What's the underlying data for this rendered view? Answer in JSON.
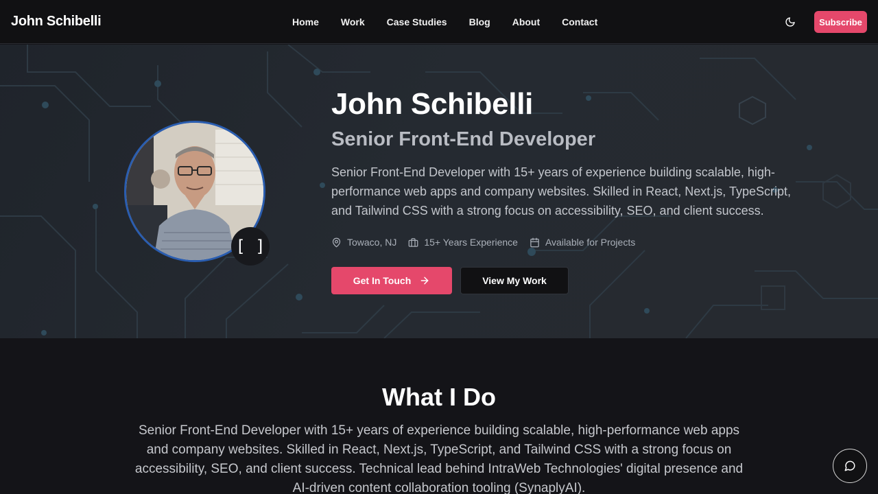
{
  "nav": {
    "brand": "John Schibelli",
    "links": [
      "Home",
      "Work",
      "Case Studies",
      "Blog",
      "About",
      "Contact"
    ],
    "subscribe_label": "Subscribe",
    "theme_icon": "moon-icon"
  },
  "hero": {
    "name": "John Schibelli",
    "role": "Senior Front-End Developer",
    "bio": "Senior Front-End Developer with 15+ years of experience building scalable, high-performance web apps and company websites. Skilled in React, Next.js, TypeScript, and Tailwind CSS with a strong focus on accessibility, SEO, and client success.",
    "meta": {
      "location": "Towaco, NJ",
      "experience": "15+ Years Experience",
      "availability": "Available for Projects"
    },
    "badge_glyph": "[ ]",
    "cta_primary": "Get In Touch",
    "cta_secondary": "View My Work"
  },
  "what_i_do": {
    "title": "What I Do",
    "text": "Senior Front-End Developer with 15+ years of experience building scalable, high-performance web apps and company websites. Skilled in React, Next.js, TypeScript, and Tailwind CSS with a strong focus on accessibility, SEO, and client success. Technical lead behind IntraWeb Technologies' digital presence and AI-driven content collaboration tooling (SynaplyAI)."
  },
  "colors": {
    "accent": "#e5486b",
    "nav_bg": "#111113",
    "hero_bg": "#23282f",
    "page_bg": "#141418",
    "avatar_ring": "#2a5db0"
  },
  "icons": {
    "location": "map-pin-icon",
    "experience": "briefcase-icon",
    "availability": "calendar-icon",
    "cta_arrow": "arrow-right-icon",
    "chat": "chat-bubble-icon"
  }
}
